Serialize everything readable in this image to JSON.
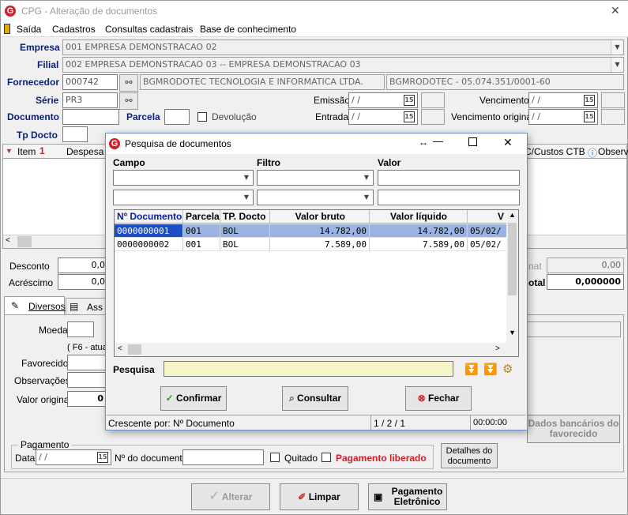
{
  "window": {
    "title": "CPG - Alteração de documentos",
    "close": "✕"
  },
  "menu": {
    "items": [
      "Saída",
      "Cadastros",
      "Consultas cadastrais",
      "Base de conhecimento"
    ]
  },
  "form": {
    "empresa_label": "Empresa",
    "empresa_value": "001 EMPRESA DEMONSTRACAO 02",
    "filial_label": "Filial",
    "filial_value": "002 EMPRESA DEMONSTRACAO 03 -- EMPRESA DEMONSTRACAO 03",
    "fornecedor_label": "Fornecedor",
    "fornecedor_code": "000742",
    "fornecedor_name": "BGMRODOTEC TECNOLOGIA E INFORMATICA LTDA.",
    "fornecedor_doc": "BGMRODOTEC - 05.074.351/0001-60",
    "serie_label": "Série",
    "serie_value": "PR3",
    "documento_label": "Documento",
    "parcela_label": "Parcela",
    "devolucao_label": "Devolução",
    "tpdocto_label": "Tp Docto",
    "emissao_label": "Emissão",
    "emissao_value": "/ /",
    "entrada_label": "Entrada",
    "entrada_value": "/ /",
    "vencimento_label": "Vencimento",
    "vencimento_value": "/ /",
    "venc_original_label": "Vencimento original",
    "venc_original_value": "/ /",
    "cal_glyph": "15"
  },
  "items_grid": {
    "col_item": "Item",
    "col_despesa": "Despesa",
    "col_ccustos": "C/Custos CTB",
    "col_observ": "Observ"
  },
  "totals": {
    "desconto_label": "Desconto",
    "desconto_value": "0,0",
    "acrescimo_label": "Acréscimo",
    "acrescimo_value": "0,0",
    "mat_label": "nat",
    "mat_value": "0,00",
    "total_label": "otal",
    "total_value": "0,000000"
  },
  "tabs": {
    "diversos": "Diversos",
    "ass": "Ass"
  },
  "diversos": {
    "moeda_label": "Moeda",
    "f6_text": "( F6 - atua",
    "favorecido_label": "Favorecido",
    "observacoes_label": "Observações",
    "valor_original_label": "Valor original",
    "valor_original_value": "0"
  },
  "dados_bancarios": "Dados bancários do favorecido",
  "pagamento": {
    "group_label": "Pagamento",
    "data_label": "Data",
    "data_value": "/ /",
    "ndoc_label": "Nº do documento",
    "quitado_label": "Quitado",
    "liberado_label": "Pagamento liberado",
    "detalhes_label": "Detalhes do documento"
  },
  "bottom_buttons": {
    "alterar": "Alterar",
    "limpar": "Limpar",
    "pagamento": "Pagamento Eletrônico"
  },
  "dialog": {
    "title": "Pesquisa de documentos",
    "campo_label": "Campo",
    "filtro_label": "Filtro",
    "valor_label": "Valor",
    "columns": [
      "Nº Documento",
      "Parcela",
      "TP. Docto",
      "Valor bruto",
      "Valor líquido",
      "V"
    ],
    "rows": [
      [
        "0000000001",
        "001",
        "BOL",
        "14.782,00",
        "14.782,00",
        "05/02/"
      ],
      [
        "0000000002",
        "001",
        "BOL",
        "7.589,00",
        "7.589,00",
        "05/02/"
      ]
    ],
    "pesquisa_label": "Pesquisa",
    "confirmar": "Confirmar",
    "consultar": "Consultar",
    "fechar": "Fechar",
    "status_sort": "Crescente por: Nº Documento",
    "status_count": "1 / 2 / 1",
    "status_time": "00:00:00",
    "selected_color": "#99b4e0"
  }
}
